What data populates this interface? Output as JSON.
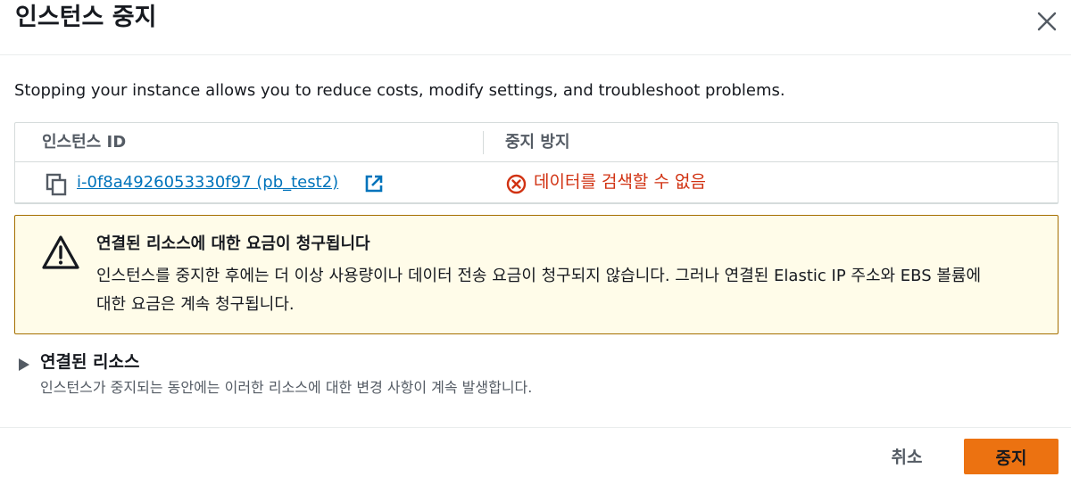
{
  "modal": {
    "title": "인스턴스 중지",
    "close_icon": "close-icon"
  },
  "intro": {
    "text": "Stopping your instance allows you to reduce costs, modify settings, and troubleshoot problems."
  },
  "table": {
    "headers": [
      "인스턴스 ID",
      "중지 방지"
    ],
    "rows": [
      {
        "instance_id": "i-0f8a4926053330f97 (pb_test2)",
        "stop_protection": "데이터를 검색할 수 없음",
        "status_color": "#d13212"
      }
    ]
  },
  "alert": {
    "type": "warning",
    "icon": "warning-icon",
    "title": "연결된 리소스에 대한 요금이 청구됩니다",
    "body": "인스턴스를 중지한 후에는 더 이상 사용량이나 데이터 전송 요금이 청구되지 않습니다. 그러나 연결된 Elastic IP 주소와 EBS 볼륨에 대한 요금은 계속 청구됩니다."
  },
  "expander": {
    "title": "연결된 리소스",
    "description": "인스턴스가 중지되는 동안에는 이러한 리소스에 대한 변경 사항이 계속 발생합니다."
  },
  "footer": {
    "cancel_label": "취소",
    "stop_label": "중지",
    "primary_color": "#ec7211"
  }
}
